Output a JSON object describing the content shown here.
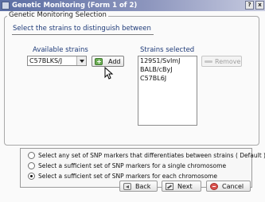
{
  "window": {
    "title": "Genetic Monitoring (Form 1 of 2)",
    "help_label": "?",
    "close_label": "x"
  },
  "group": {
    "legend": "Genetic Monitoring Selection",
    "instruction": "Select the strains to distinguish between"
  },
  "available": {
    "label": "Available strains",
    "selected_value": "C57BLKS/J"
  },
  "selected": {
    "label": "Strains selected",
    "items": [
      "129S1/SvImJ",
      "BALB/cByJ",
      "C57BL6J"
    ]
  },
  "buttons": {
    "add": "Add",
    "remove": "Remove",
    "back": "Back",
    "next": "Next",
    "cancel": "Cancel"
  },
  "options": [
    {
      "label": "Select any set of SNP markers that differentiates between strains ( Default )",
      "selected": false
    },
    {
      "label": "Select a sufficient set of SNP markers for a single chromosome",
      "selected": false
    },
    {
      "label": "Select a sufficient set of SNP markers for each chromosome",
      "selected": true
    }
  ],
  "icons": {
    "window": "window-icon",
    "add": "add-icon",
    "remove": "remove-icon",
    "back": "back-icon",
    "next": "next-icon",
    "cancel": "cancel-icon",
    "cursor": "mouse-cursor-icon"
  },
  "colors": {
    "title_start": "#5b6ea3",
    "title_end": "#c7cbe0",
    "label_blue": "#1e3a78",
    "add_green": "#6eae57",
    "cancel_red": "#d9534f"
  }
}
